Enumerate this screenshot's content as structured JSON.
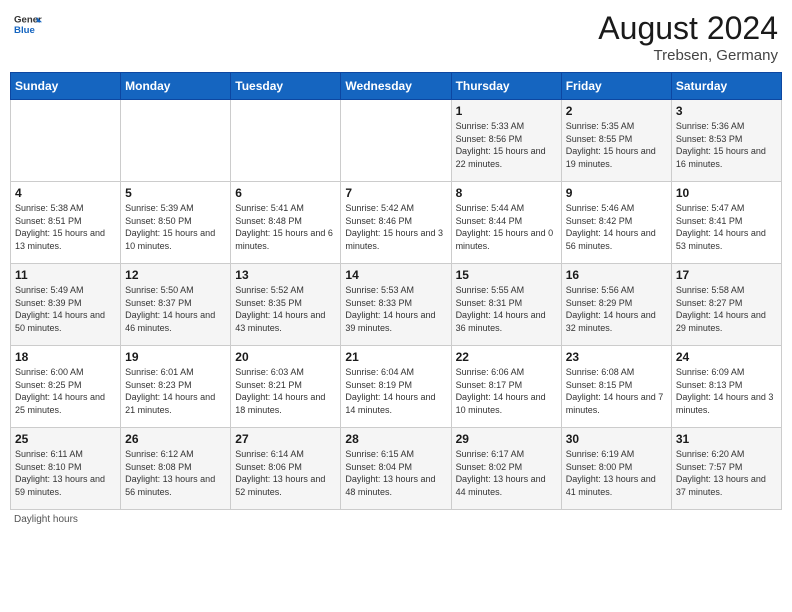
{
  "header": {
    "logo_general": "General",
    "logo_blue": "Blue",
    "month_year": "August 2024",
    "location": "Trebsen, Germany"
  },
  "days_of_week": [
    "Sunday",
    "Monday",
    "Tuesday",
    "Wednesday",
    "Thursday",
    "Friday",
    "Saturday"
  ],
  "weeks": [
    [
      {
        "num": "",
        "sunrise": "",
        "sunset": "",
        "daylight": ""
      },
      {
        "num": "",
        "sunrise": "",
        "sunset": "",
        "daylight": ""
      },
      {
        "num": "",
        "sunrise": "",
        "sunset": "",
        "daylight": ""
      },
      {
        "num": "",
        "sunrise": "",
        "sunset": "",
        "daylight": ""
      },
      {
        "num": "1",
        "sunrise": "Sunrise: 5:33 AM",
        "sunset": "Sunset: 8:56 PM",
        "daylight": "Daylight: 15 hours and 22 minutes."
      },
      {
        "num": "2",
        "sunrise": "Sunrise: 5:35 AM",
        "sunset": "Sunset: 8:55 PM",
        "daylight": "Daylight: 15 hours and 19 minutes."
      },
      {
        "num": "3",
        "sunrise": "Sunrise: 5:36 AM",
        "sunset": "Sunset: 8:53 PM",
        "daylight": "Daylight: 15 hours and 16 minutes."
      }
    ],
    [
      {
        "num": "4",
        "sunrise": "Sunrise: 5:38 AM",
        "sunset": "Sunset: 8:51 PM",
        "daylight": "Daylight: 15 hours and 13 minutes."
      },
      {
        "num": "5",
        "sunrise": "Sunrise: 5:39 AM",
        "sunset": "Sunset: 8:50 PM",
        "daylight": "Daylight: 15 hours and 10 minutes."
      },
      {
        "num": "6",
        "sunrise": "Sunrise: 5:41 AM",
        "sunset": "Sunset: 8:48 PM",
        "daylight": "Daylight: 15 hours and 6 minutes."
      },
      {
        "num": "7",
        "sunrise": "Sunrise: 5:42 AM",
        "sunset": "Sunset: 8:46 PM",
        "daylight": "Daylight: 15 hours and 3 minutes."
      },
      {
        "num": "8",
        "sunrise": "Sunrise: 5:44 AM",
        "sunset": "Sunset: 8:44 PM",
        "daylight": "Daylight: 15 hours and 0 minutes."
      },
      {
        "num": "9",
        "sunrise": "Sunrise: 5:46 AM",
        "sunset": "Sunset: 8:42 PM",
        "daylight": "Daylight: 14 hours and 56 minutes."
      },
      {
        "num": "10",
        "sunrise": "Sunrise: 5:47 AM",
        "sunset": "Sunset: 8:41 PM",
        "daylight": "Daylight: 14 hours and 53 minutes."
      }
    ],
    [
      {
        "num": "11",
        "sunrise": "Sunrise: 5:49 AM",
        "sunset": "Sunset: 8:39 PM",
        "daylight": "Daylight: 14 hours and 50 minutes."
      },
      {
        "num": "12",
        "sunrise": "Sunrise: 5:50 AM",
        "sunset": "Sunset: 8:37 PM",
        "daylight": "Daylight: 14 hours and 46 minutes."
      },
      {
        "num": "13",
        "sunrise": "Sunrise: 5:52 AM",
        "sunset": "Sunset: 8:35 PM",
        "daylight": "Daylight: 14 hours and 43 minutes."
      },
      {
        "num": "14",
        "sunrise": "Sunrise: 5:53 AM",
        "sunset": "Sunset: 8:33 PM",
        "daylight": "Daylight: 14 hours and 39 minutes."
      },
      {
        "num": "15",
        "sunrise": "Sunrise: 5:55 AM",
        "sunset": "Sunset: 8:31 PM",
        "daylight": "Daylight: 14 hours and 36 minutes."
      },
      {
        "num": "16",
        "sunrise": "Sunrise: 5:56 AM",
        "sunset": "Sunset: 8:29 PM",
        "daylight": "Daylight: 14 hours and 32 minutes."
      },
      {
        "num": "17",
        "sunrise": "Sunrise: 5:58 AM",
        "sunset": "Sunset: 8:27 PM",
        "daylight": "Daylight: 14 hours and 29 minutes."
      }
    ],
    [
      {
        "num": "18",
        "sunrise": "Sunrise: 6:00 AM",
        "sunset": "Sunset: 8:25 PM",
        "daylight": "Daylight: 14 hours and 25 minutes."
      },
      {
        "num": "19",
        "sunrise": "Sunrise: 6:01 AM",
        "sunset": "Sunset: 8:23 PM",
        "daylight": "Daylight: 14 hours and 21 minutes."
      },
      {
        "num": "20",
        "sunrise": "Sunrise: 6:03 AM",
        "sunset": "Sunset: 8:21 PM",
        "daylight": "Daylight: 14 hours and 18 minutes."
      },
      {
        "num": "21",
        "sunrise": "Sunrise: 6:04 AM",
        "sunset": "Sunset: 8:19 PM",
        "daylight": "Daylight: 14 hours and 14 minutes."
      },
      {
        "num": "22",
        "sunrise": "Sunrise: 6:06 AM",
        "sunset": "Sunset: 8:17 PM",
        "daylight": "Daylight: 14 hours and 10 minutes."
      },
      {
        "num": "23",
        "sunrise": "Sunrise: 6:08 AM",
        "sunset": "Sunset: 8:15 PM",
        "daylight": "Daylight: 14 hours and 7 minutes."
      },
      {
        "num": "24",
        "sunrise": "Sunrise: 6:09 AM",
        "sunset": "Sunset: 8:13 PM",
        "daylight": "Daylight: 14 hours and 3 minutes."
      }
    ],
    [
      {
        "num": "25",
        "sunrise": "Sunrise: 6:11 AM",
        "sunset": "Sunset: 8:10 PM",
        "daylight": "Daylight: 13 hours and 59 minutes."
      },
      {
        "num": "26",
        "sunrise": "Sunrise: 6:12 AM",
        "sunset": "Sunset: 8:08 PM",
        "daylight": "Daylight: 13 hours and 56 minutes."
      },
      {
        "num": "27",
        "sunrise": "Sunrise: 6:14 AM",
        "sunset": "Sunset: 8:06 PM",
        "daylight": "Daylight: 13 hours and 52 minutes."
      },
      {
        "num": "28",
        "sunrise": "Sunrise: 6:15 AM",
        "sunset": "Sunset: 8:04 PM",
        "daylight": "Daylight: 13 hours and 48 minutes."
      },
      {
        "num": "29",
        "sunrise": "Sunrise: 6:17 AM",
        "sunset": "Sunset: 8:02 PM",
        "daylight": "Daylight: 13 hours and 44 minutes."
      },
      {
        "num": "30",
        "sunrise": "Sunrise: 6:19 AM",
        "sunset": "Sunset: 8:00 PM",
        "daylight": "Daylight: 13 hours and 41 minutes."
      },
      {
        "num": "31",
        "sunrise": "Sunrise: 6:20 AM",
        "sunset": "Sunset: 7:57 PM",
        "daylight": "Daylight: 13 hours and 37 minutes."
      }
    ]
  ],
  "footer_note": "Daylight hours"
}
